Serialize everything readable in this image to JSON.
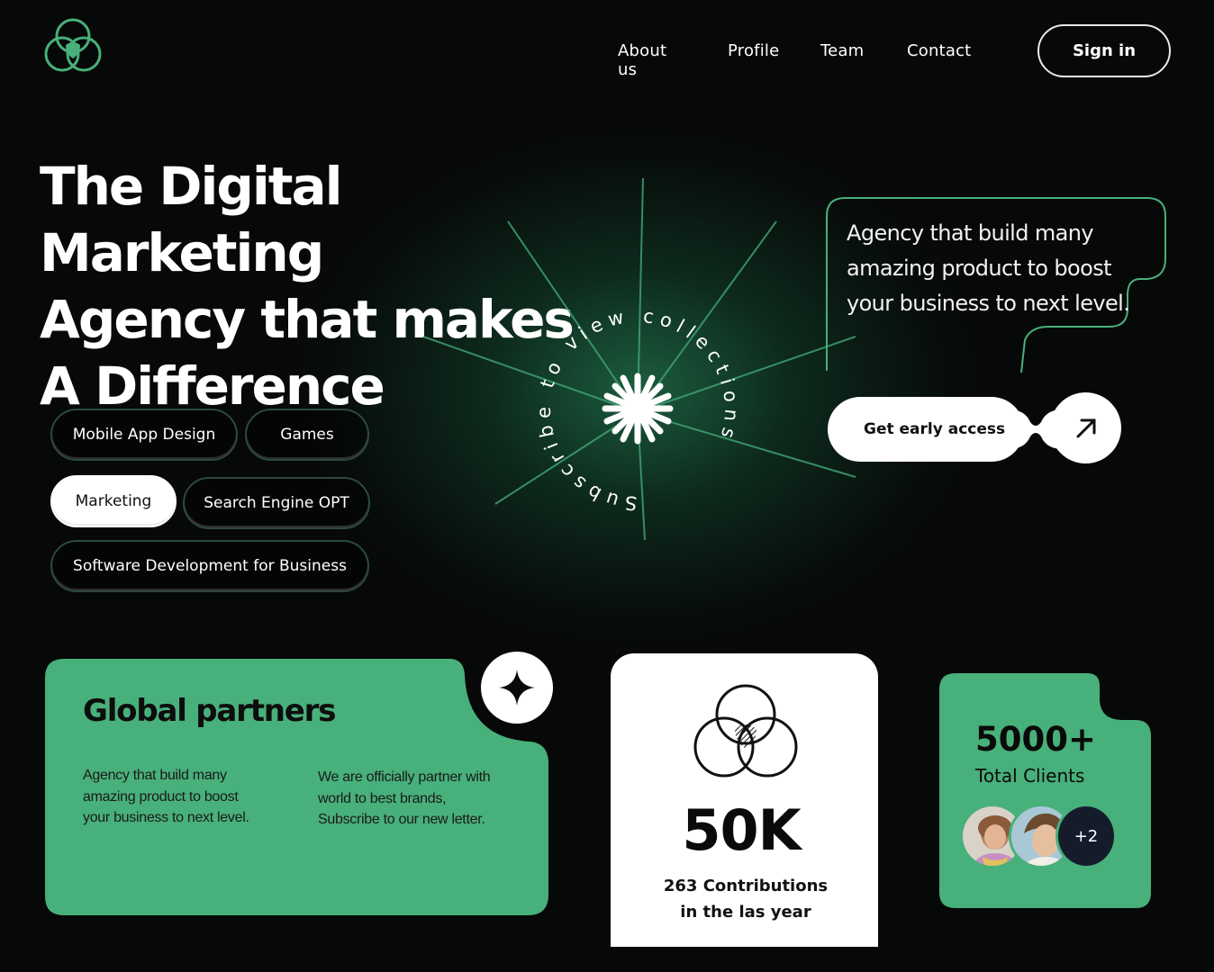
{
  "nav": {
    "links": [
      "About us",
      "Profile",
      "Team",
      "Contact"
    ],
    "signin_label": "Sign in"
  },
  "hero": {
    "headline_lines": [
      "The Digital Marketing",
      "Agency that makes",
      "A Difference"
    ]
  },
  "tags": [
    "Mobile App Design",
    "Games",
    "Marketing",
    "Search Engine OPT",
    "Software Development for Business"
  ],
  "active_tag": "Marketing",
  "circle_text": "Subscribe to view collections",
  "quote": "Agency that build many amazing product to boost your business to next level.",
  "cta": {
    "label": "Get early access",
    "icon": "arrow-up-right-icon"
  },
  "partners": {
    "title": "Global partners",
    "text_left": "Agency that build many amazing product to boost your business to next level.",
    "text_right": "We are officially partner with world to best brands, Subscribe to our new letter.",
    "icon": "sparkle-icon"
  },
  "contributions": {
    "value": "50K",
    "label_line1": "263 Contributions",
    "label_line2": "in the las year"
  },
  "clients": {
    "value": "5000+",
    "label": "Total Clients",
    "more": "+2"
  },
  "colors": {
    "accent_green": "#48b07a",
    "background": "#070808",
    "card_white": "#ffffff"
  }
}
